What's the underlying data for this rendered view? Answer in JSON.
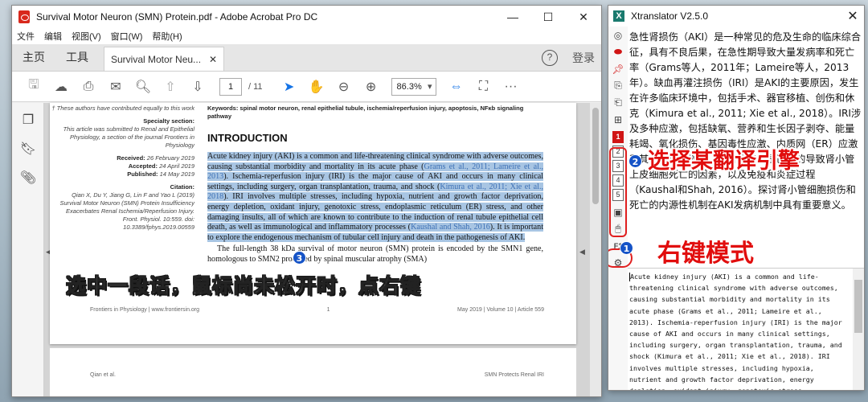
{
  "acrobat": {
    "window_title": "Survival Motor Neuron (SMN) Protein.pdf - Adobe Acrobat Pro DC",
    "menu": [
      "文件",
      "编辑",
      "视图(V)",
      "窗口(W)",
      "帮助(H)"
    ],
    "tabs": {
      "home": "主页",
      "tools": "工具",
      "doc": "Survival Motor Neu...",
      "login": "登录"
    },
    "toolbar": {
      "page_current": "1",
      "page_total": "/ 11",
      "zoom": "86.3%"
    },
    "page": {
      "left_col": {
        "note": "† These authors have contributed equally to this work",
        "specialty_head": "Specialty section:",
        "specialty_body": "This article was submitted to Renal and Epithelial Physiology, a section of the journal Frontiers in Physiology",
        "received_label": "Received:",
        "received": "26 February 2019",
        "accepted_label": "Accepted:",
        "accepted": "24 April 2019",
        "published_label": "Published:",
        "published": "14 May 2019",
        "citation_head": "Citation:",
        "citation_body": "Qian X, Du Y, Jiang G, Lin F and Yao L (2019) Survival Motor Neuron (SMN) Protein Insufficiency Exacerbates Renal Ischemia/Reperfusion Injury. Front. Physiol. 10:559. doi: 10.3389/fphys.2019.00559"
      },
      "keywords": "Keywords: spinal motor neuron, renal epithelial tubule, ischemia/reperfusion injury, apoptosis, NFκb signaling pathway",
      "heading": "INTRODUCTION",
      "para1_a": "Acute kidney injury (AKI) is a common and life-threatening clinical syndrome with adverse outcomes, causing substantial morbidity and mortality in its acute phase (",
      "para1_c1": "Grams et al., 2011; Lameire et al., 2013",
      "para1_b": "). Ischemia-reperfusion injury (IRI) is the major cause of AKI and occurs in many clinical settings, including surgery, organ transplantation, trauma, and shock (",
      "para1_c2": "Kimura et al., 2011; Xie et al., 2018",
      "para1_c": "). IRI involves multiple stresses, including hypoxia, nutrient and growth factor deprivation, energy depletion, oxidant injury, genotoxic stress, endoplasmic reticulum (ER) stress, and other damaging insults, all of which are known to contribute to the induction of renal tubule epithelial cell death, as well as immunological and inflammatory processes (",
      "para1_c3": "Kaushal and Shah, 2016",
      "para1_d": "). It is important to explore the endogenous mechanism of tubular cell injury and death in the pathogenesis of AKI.",
      "para2": "The full-length 38 kDa survival of motor neuron (SMN) protein is encoded by the SMN1 gene, homologous to SMN2 produced by spinal muscular atrophy (SMA)",
      "footer_left": "Frontiers in Physiology | www.frontiersin.org",
      "footer_mid": "1",
      "footer_right": "May 2019 | Volume 10 | Article 559",
      "p2_left": "Qian et al.",
      "p2_right": "SMN Protects Renal IRI"
    }
  },
  "xtranslator": {
    "title": "Xtranslator V2.5.0",
    "engines": [
      "1",
      "2",
      "3",
      "4",
      "5"
    ],
    "active_engine": "1",
    "output": "急性肾损伤（AKI）是一种常见的危及生命的临床综合征，具有不良后果，在急性期导致大量发病率和死亡率（Grams等人，2011年；Lameire等人，2013年）。缺血再灌注损伤（IRI）是AKI的主要原因，发生在许多临床环境中，包括手术、器官移植、创伤和休克（Kimura et al., 2011; Xie et al., 2018）。IRI涉及多种应激，包括缺氧、营养和生长因子剥夺、能量耗竭、氧化损伤、基因毒性应激、内质网（ER）应激和其他损伤性损伤，所有这些都是已知的导致肾小管上皮细胞死亡的因素，以及免疫和炎症过程（Kaushal和Shah, 2016）。探讨肾小管细胞损伤和死亡的内源性机制在AKI发病机制中具有重要意义。",
    "input": "Acute kidney injury (AKI) is a common and life-threatening clinical syndrome with adverse outcomes, causing substantial morbidity and mortality in its acute phase (Grams et al., 2011; Lameire et al., 2013). Ischemia-reperfusion injury (IRI) is the major cause of AKI and occurs in many clinical settings, including surgery, organ transplantation, trauma, and shock (Kimura et al., 2011; Xie et al., 2018). IRI involves multiple stresses, including hypoxia, nutrient and growth factor deprivation, energy depletion, oxidant injury, genotoxic stress"
  },
  "annotations": {
    "select_engine": "选择某翻译引擎",
    "right_click_mode": "右键模式",
    "instruction": "选中一段话，鼠标尚未松开时，点右键",
    "badge1": "1",
    "badge2": "2",
    "badge3": "3"
  },
  "colors": {
    "accent_blue": "#1473e6",
    "annotation_red": "#e10d0d",
    "highlight": "#a8c5e3"
  }
}
